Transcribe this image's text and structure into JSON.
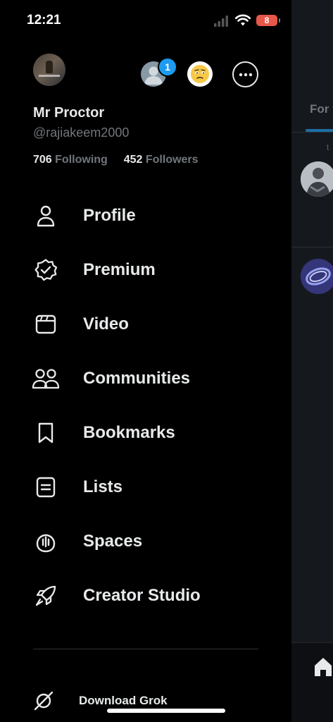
{
  "status_bar": {
    "time": "12:21",
    "battery": "8"
  },
  "profile": {
    "display_name": "Mr Proctor",
    "handle": "@rajiakeem2000",
    "following_count": "706",
    "following_label": "Following",
    "followers_count": "452",
    "followers_label": "Followers",
    "notification_badge": "1"
  },
  "menu": {
    "items": [
      {
        "label": "Profile",
        "icon": "person-icon"
      },
      {
        "label": "Premium",
        "icon": "verified-badge-icon"
      },
      {
        "label": "Video",
        "icon": "video-icon"
      },
      {
        "label": "Communities",
        "icon": "communities-icon"
      },
      {
        "label": "Bookmarks",
        "icon": "bookmark-icon"
      },
      {
        "label": "Lists",
        "icon": "list-icon"
      },
      {
        "label": "Spaces",
        "icon": "spaces-icon"
      },
      {
        "label": "Creator Studio",
        "icon": "rocket-icon"
      }
    ]
  },
  "grok": {
    "label": "Download Grok",
    "icon": "grok-icon"
  },
  "backdrop": {
    "tab_label": "For you",
    "snippet": "t"
  },
  "colors": {
    "background": "#000000",
    "text_primary": "#e7e9ea",
    "text_secondary": "#71767b",
    "accent": "#1d9bf0"
  }
}
